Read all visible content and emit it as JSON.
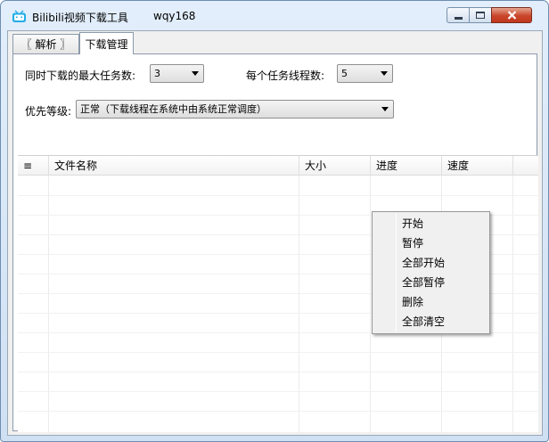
{
  "window": {
    "title": "Bilibili视频下载工具",
    "author": "wqy168"
  },
  "tabs": [
    {
      "label": "〖 解析 〗",
      "selected": false
    },
    {
      "label": "下载管理",
      "selected": true
    }
  ],
  "settings": {
    "max_tasks_label": "同时下载的最大任务数:",
    "max_tasks_value": "3",
    "threads_label": "每个任务线程数:",
    "threads_value": "5",
    "priority_label": "优先等级:",
    "priority_value": "正常（下载线程在系统中由系统正常调度）"
  },
  "table": {
    "columns": [
      "≡",
      "文件名称",
      "大小",
      "进度",
      "速度"
    ],
    "rows": []
  },
  "context_menu": {
    "items": [
      "开始",
      "暂停",
      "全部开始",
      "全部暂停",
      "删除",
      "全部清空"
    ]
  },
  "colors": {
    "title_bar": "#dbe8f8",
    "close_button": "#c9452a",
    "app_icon": "#23ade5"
  }
}
